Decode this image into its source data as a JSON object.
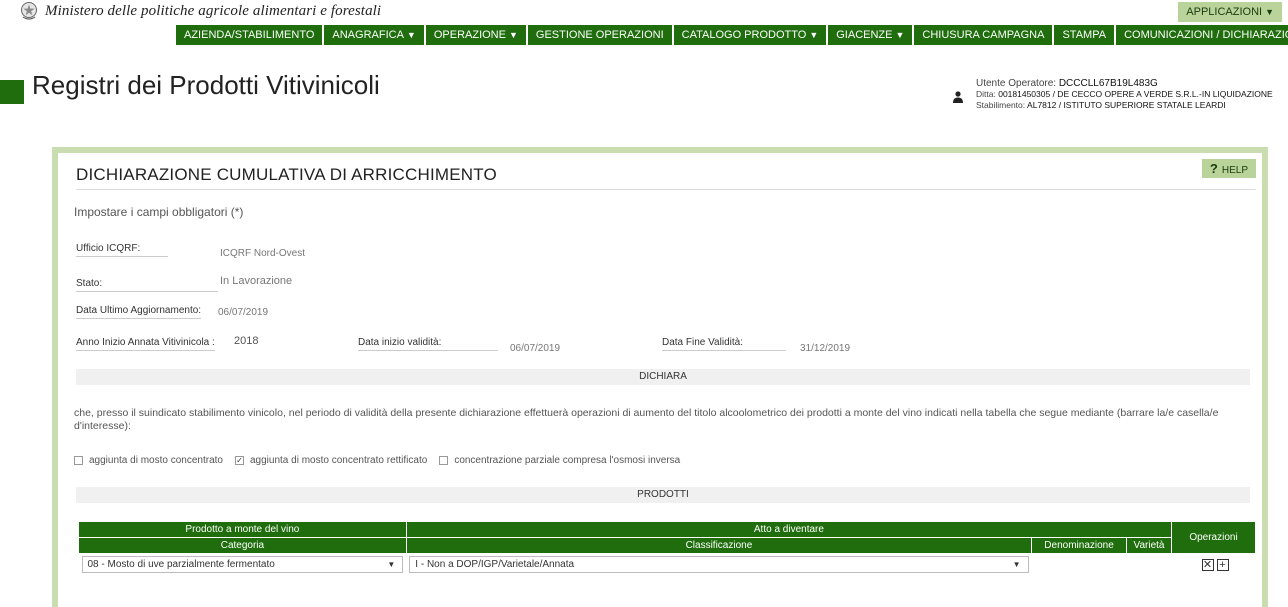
{
  "header": {
    "ministry": "Ministero delle politiche agricole alimentari e forestali",
    "apps_label": "APPLICAZIONI",
    "page_title": "Registri dei Prodotti Vitivinicoli"
  },
  "nav": [
    {
      "label": "AZIENDA/STABILIMENTO",
      "dropdown": false
    },
    {
      "label": "ANAGRAFICA",
      "dropdown": true
    },
    {
      "label": "OPERAZIONE",
      "dropdown": true
    },
    {
      "label": "GESTIONE OPERAZIONI",
      "dropdown": false
    },
    {
      "label": "CATALOGO PRODOTTO",
      "dropdown": true
    },
    {
      "label": "GIACENZE",
      "dropdown": true
    },
    {
      "label": "CHIUSURA CAMPAGNA",
      "dropdown": false
    },
    {
      "label": "STAMPA",
      "dropdown": false
    },
    {
      "label": "COMUNICAZIONI / DICHIARAZIONI",
      "dropdown": true
    }
  ],
  "user": {
    "operator_label": "Utente Operatore:",
    "operator_value": "DCCCLL67B19L483G",
    "ditta_label": "Ditta:",
    "ditta_value": "00181450305 / DE CECCO OPERE A VERDE S.R.L.-IN LIQUIDAZIONE",
    "stabilimento_label": "Stabilimento:",
    "stabilimento_value": "AL7812 / ISTITUTO SUPERIORE STATALE LEARDI"
  },
  "form": {
    "help_label": "HELP",
    "title": "DICHIARAZIONE CUMULATIVA DI ARRICCHIMENTO",
    "hint": "Impostare i campi obbligatori (*)",
    "ufficio_label": "Ufficio ICQRF:",
    "ufficio_value": "ICQRF Nord-Ovest",
    "stato_label": "Stato:",
    "stato_value": "In Lavorazione",
    "aggiornamento_label": "Data Ultimo Aggiornamento:",
    "aggiornamento_value": "06/07/2019",
    "anno_label": "Anno Inizio Annata Vitivinicola :",
    "anno_value": "2018",
    "inizio_label": "Data inizio validità:",
    "inizio_value": "06/07/2019",
    "fine_label": "Data Fine Validità:",
    "fine_value": "31/12/2019",
    "dichiara_band": "DICHIARA",
    "paragraph": "che, presso il suindicato stabilimento vinicolo, nel periodo di validità della presente dichiarazione effettuerà operazioni di aumento del titolo alcoolometrico dei prodotti a monte del vino indicati nella tabella che segue mediante (barrare la/e casella/e d'interesse):",
    "checkboxes": [
      {
        "label": "aggiunta di mosto concentrato",
        "checked": false
      },
      {
        "label": "aggiunta di mosto concentrato rettificato",
        "checked": true
      },
      {
        "label": "concentrazione parziale compresa l'osmosi inversa",
        "checked": false
      }
    ],
    "prodotti_band": "PRODOTTI"
  },
  "table": {
    "group_left": "Prodotto a monte del vino",
    "group_right": "Atto a diventare",
    "operazioni": "Operazioni",
    "col_categoria": "Categoria",
    "col_classificazione": "Classificazione",
    "col_denominazione": "Denominazione",
    "col_varieta": "Varietà",
    "row": {
      "categoria": "08 - Mosto di uve parzialmente fermentato",
      "classificazione": "I - Non a DOP/IGP/Varietale/Annata"
    }
  }
}
